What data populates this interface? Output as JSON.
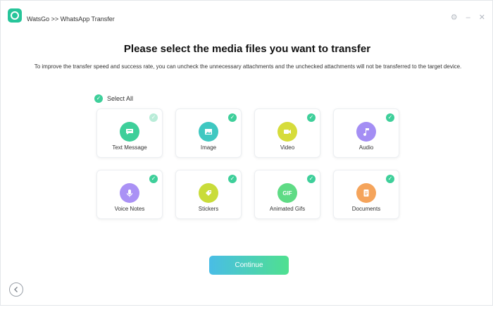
{
  "window": {
    "title": "WatsGo >> WhatsApp Transfer",
    "controls": [
      "settings-icon",
      "minimize-icon",
      "close-icon"
    ]
  },
  "main": {
    "heading": "Please select the media files you want to transfer",
    "subtitle": "To improve the transfer speed and success rate, you can uncheck the unnecessary attachments and the unchecked attachments will not be transferred to the target device.",
    "select_all": {
      "label": "Select All",
      "checked": true
    }
  },
  "media_types": [
    {
      "label": "Text Message",
      "icon": "chat-icon",
      "color": "#3ecf9a",
      "checked": true
    },
    {
      "label": "Image",
      "icon": "image-icon",
      "color": "#3fc8c1",
      "checked": true
    },
    {
      "label": "Video",
      "icon": "video-icon",
      "color": "#d6dc3b",
      "checked": true
    },
    {
      "label": "Audio",
      "icon": "music-icon",
      "color": "#a48ef4",
      "checked": true
    },
    {
      "label": "Voice Notes",
      "icon": "microphone-icon",
      "color": "#aa91f5",
      "checked": true
    },
    {
      "label": "Stickers",
      "icon": "sticker-icon",
      "color": "#c9dc3a",
      "checked": true
    },
    {
      "label": "Animated Gifs",
      "icon": "gif-icon",
      "color": "#5fdb85",
      "checked": true
    },
    {
      "label": "Documents",
      "icon": "document-icon",
      "color": "#f5a45b",
      "checked": true
    }
  ],
  "continue_label": "Continue",
  "gif_icon_text": "GIF"
}
